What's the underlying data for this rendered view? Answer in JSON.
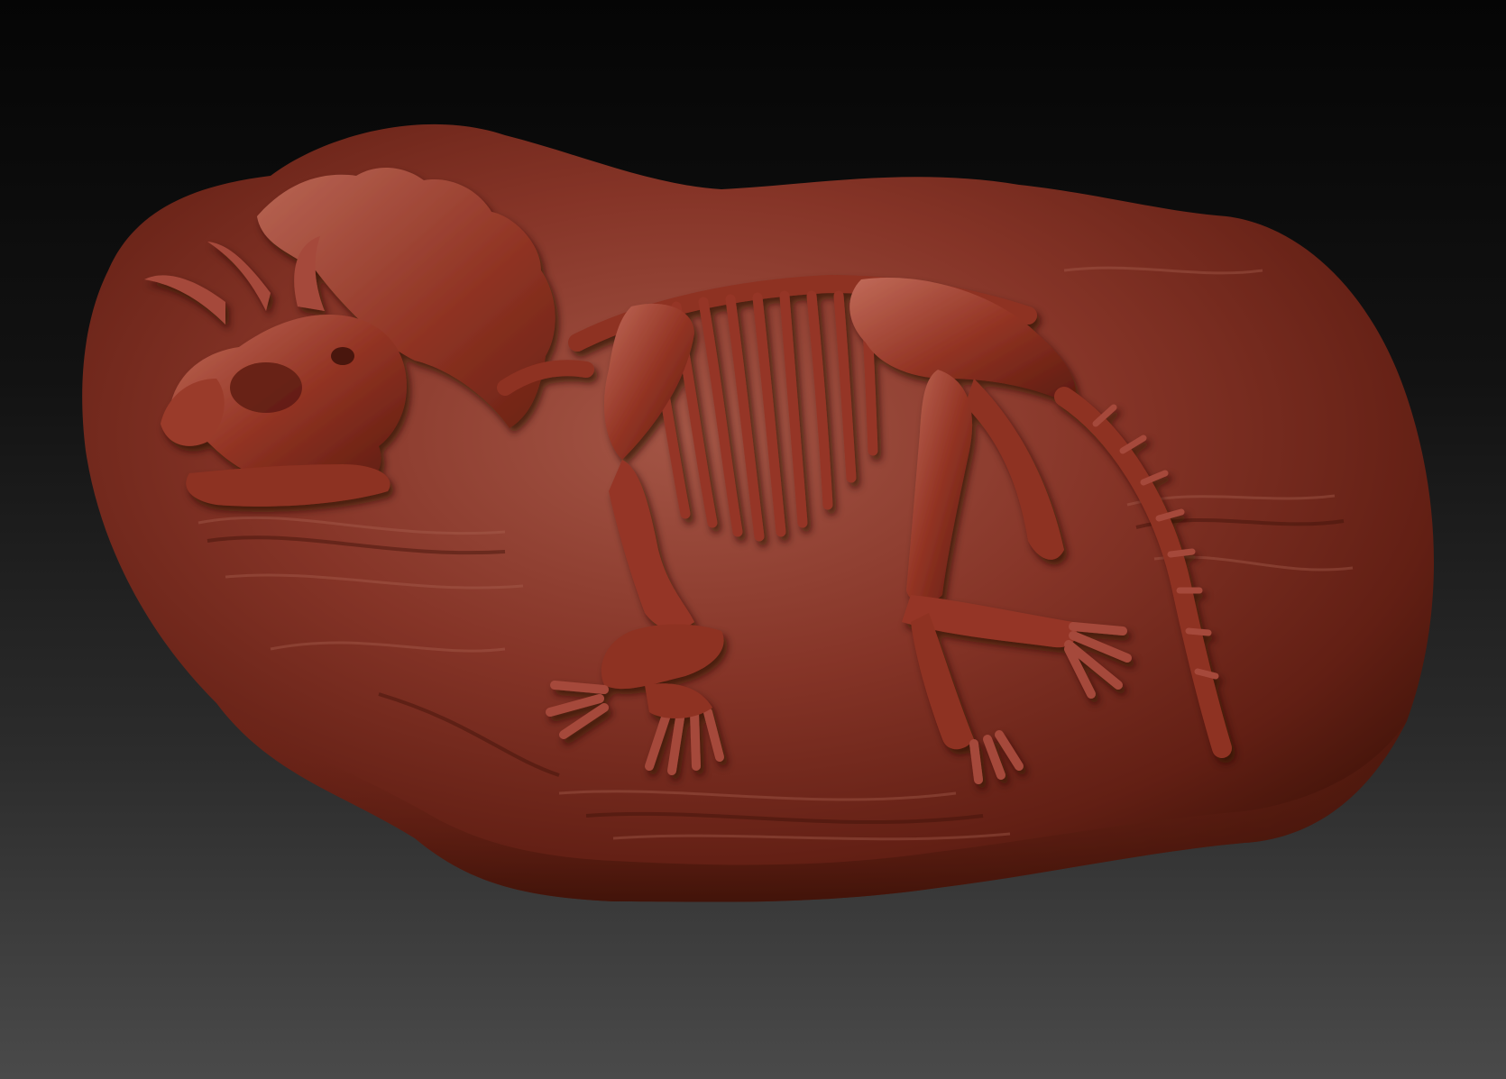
{
  "scene": {
    "subject": "sculpted-triceratops-fossil-in-rock",
    "colors": {
      "background_top": "#050505",
      "background_bottom": "#4a4a4a",
      "rock_base": "#7a2a1c",
      "rock_highlight": "#a8584a",
      "rock_shadow": "#3e1208",
      "bone_base": "#8e3122",
      "bone_highlight": "#c06a58",
      "bone_shadow": "#4a140a"
    }
  }
}
